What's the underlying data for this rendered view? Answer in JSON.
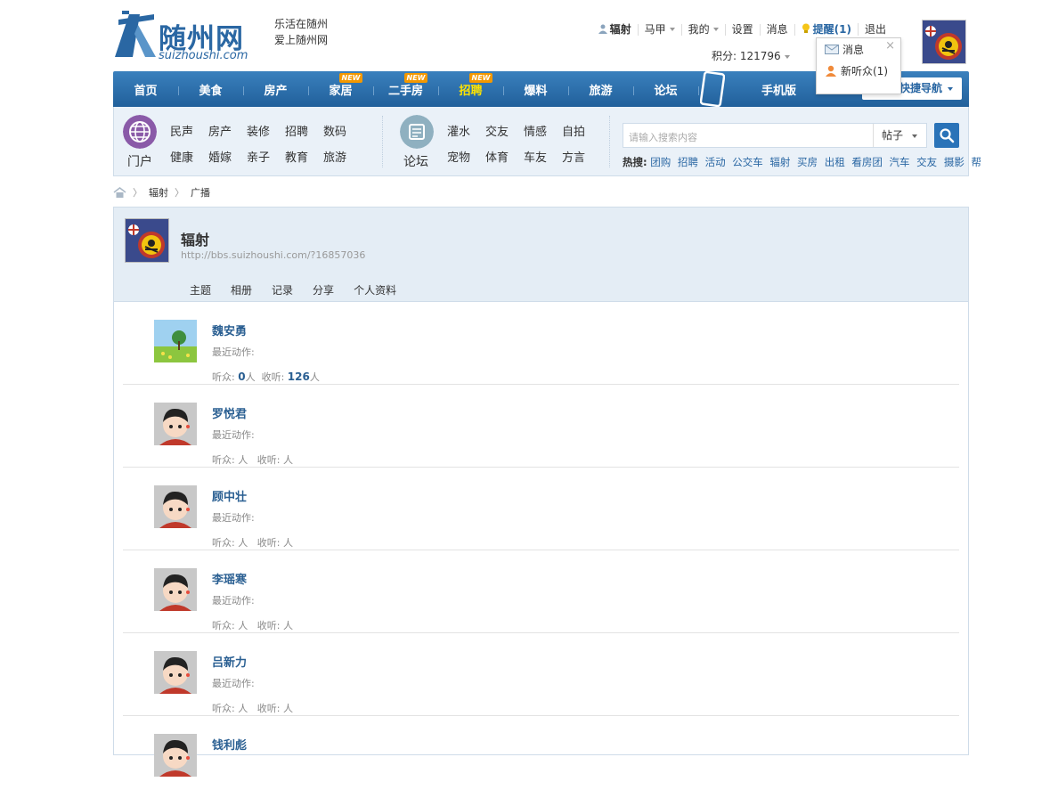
{
  "header": {
    "logo_text": "随州网",
    "logo_sub": "suizhoushi.com",
    "slogan_line1": "乐活在随州",
    "slogan_line2": "爱上随州网",
    "user": "辐射",
    "topmenu": [
      "马甲",
      "我的",
      "设置",
      "消息"
    ],
    "remind": "提醒(1)",
    "logout": "退出",
    "score": "积分: 121796"
  },
  "popup": {
    "message": "消息",
    "new_listener": "新听众(1)",
    "close": "×"
  },
  "nav": {
    "items": [
      {
        "label": "首页",
        "new": ""
      },
      {
        "label": "美食",
        "new": ""
      },
      {
        "label": "房产",
        "new": ""
      },
      {
        "label": "家居",
        "new": "NEW"
      },
      {
        "label": "二手房",
        "new": "NEW"
      },
      {
        "label": "招聘",
        "new": "NEW"
      },
      {
        "label": "爆料",
        "new": ""
      },
      {
        "label": "旅游",
        "new": ""
      },
      {
        "label": "论坛",
        "new": ""
      }
    ],
    "mobile": "手机版",
    "quick_nav": "快捷导航"
  },
  "portal": {
    "label": "门户",
    "links": [
      "民声",
      "房产",
      "装修",
      "招聘",
      "数码",
      "健康",
      "婚嫁",
      "亲子",
      "教育",
      "旅游"
    ]
  },
  "forum": {
    "label": "论坛",
    "links": [
      "灌水",
      "交友",
      "情感",
      "自拍",
      "宠物",
      "体育",
      "车友",
      "方言"
    ]
  },
  "search": {
    "placeholder": "请输入搜索内容",
    "scope": "帖子",
    "hot_label": "热搜:",
    "hot": [
      "团购",
      "招聘",
      "活动",
      "公交车",
      "辐射",
      "买房",
      "出租",
      "看房团",
      "汽车",
      "交友",
      "摄影",
      "帮"
    ]
  },
  "breadcrumb": [
    "辐射",
    "广播"
  ],
  "profile": {
    "name": "辐射",
    "url": "http://bbs.suizhoushi.com/?16857036",
    "tabs": [
      "主题",
      "相册",
      "记录",
      "分享",
      "个人资料"
    ]
  },
  "list": {
    "recent_label": "最近动作:",
    "listeners_label": "听众:",
    "following_label": "收听:",
    "unit": "人",
    "items": [
      {
        "name": "魏安勇",
        "listeners": "0",
        "following": "126",
        "avatar": "landscape"
      },
      {
        "name": "罗悦君",
        "listeners": "",
        "following": "",
        "avatar": "default"
      },
      {
        "name": "顾中壮",
        "listeners": "",
        "following": "",
        "avatar": "default"
      },
      {
        "name": "李瑶寒",
        "listeners": "",
        "following": "",
        "avatar": "default"
      },
      {
        "name": "吕新力",
        "listeners": "",
        "following": "",
        "avatar": "default"
      },
      {
        "name": "钱利彪",
        "listeners": "",
        "following": "",
        "avatar": "default"
      }
    ]
  },
  "colors": {
    "brand": "#2a67a3",
    "nav": "#2b6ba6",
    "new_tag": "#f39800",
    "highlight": "#ffe400"
  }
}
